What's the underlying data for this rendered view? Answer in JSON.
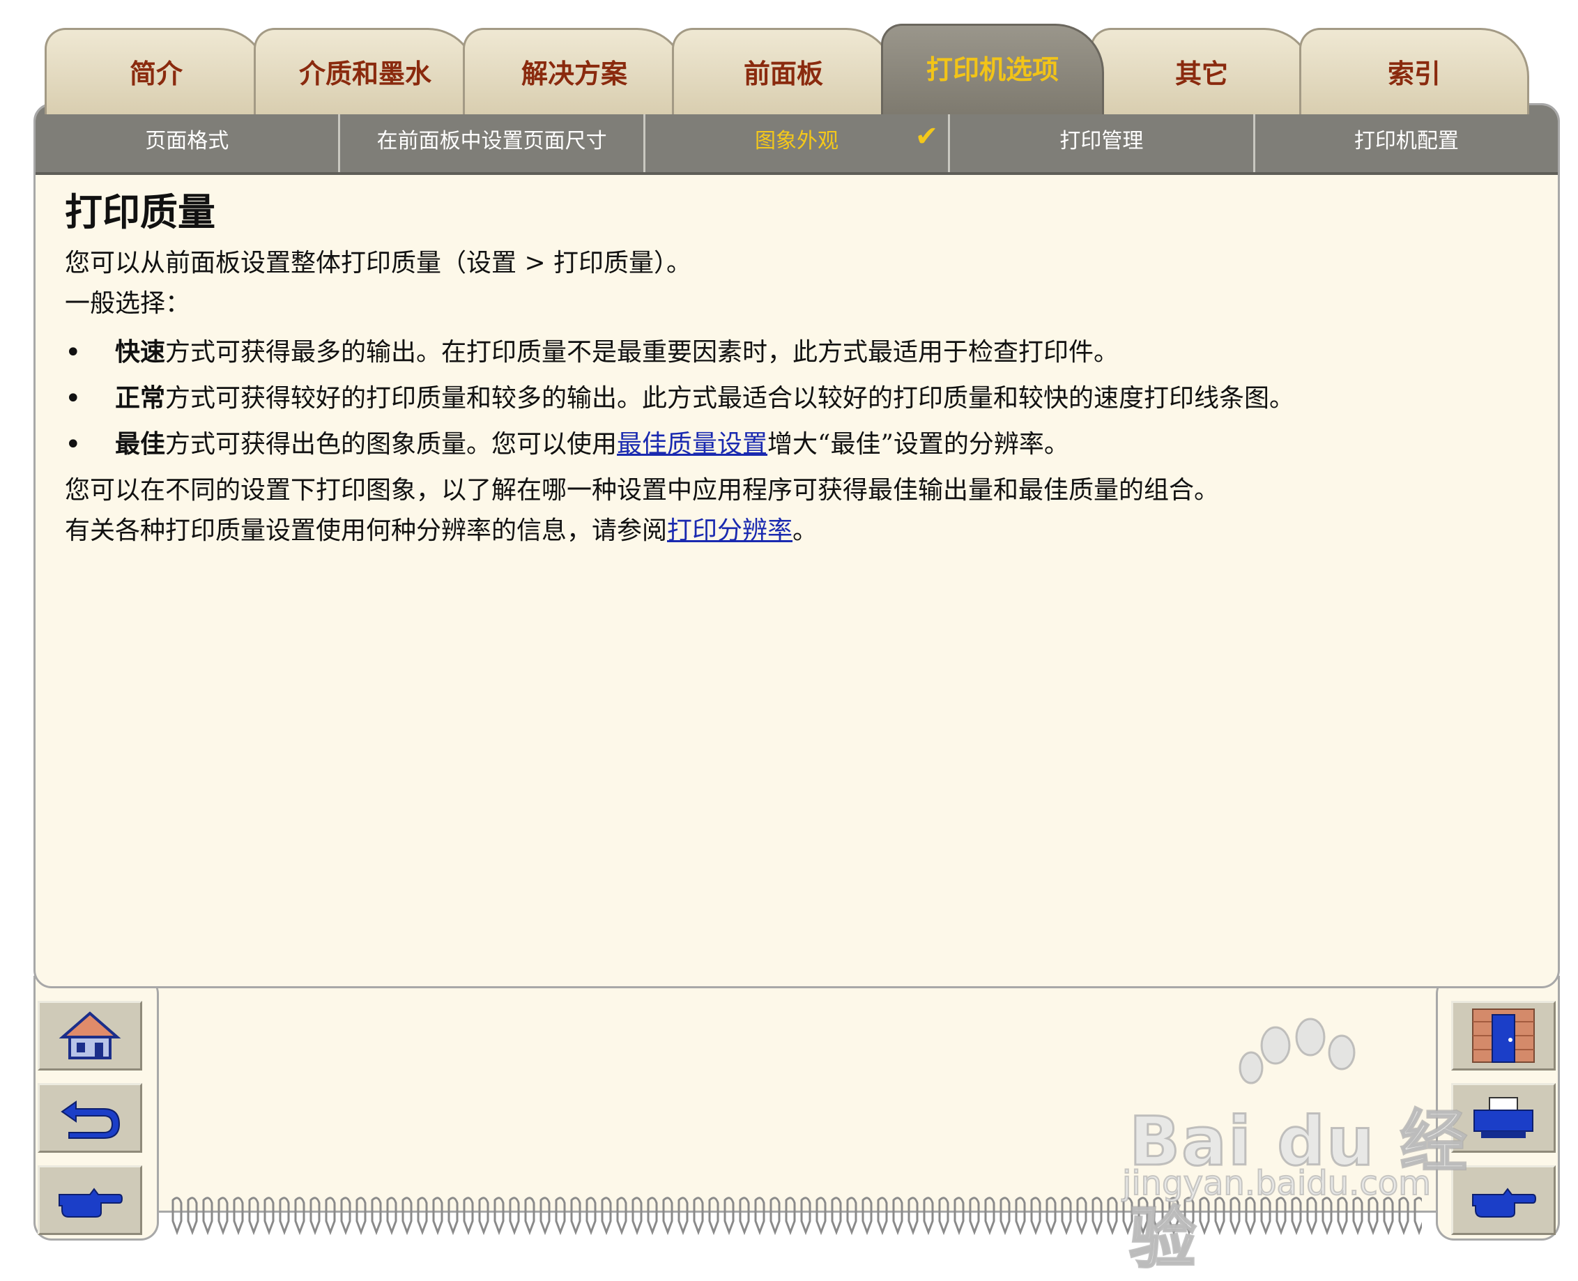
{
  "tabs": [
    {
      "label": "简介"
    },
    {
      "label": "介质和墨水"
    },
    {
      "label": "解决方案"
    },
    {
      "label": "前面板"
    },
    {
      "label": "打印机选项",
      "active": true
    },
    {
      "label": "其它"
    },
    {
      "label": "索引"
    }
  ],
  "subtabs": [
    {
      "label": "页面格式"
    },
    {
      "label": "在前面板中设置页面尺寸"
    },
    {
      "label": "图象外观",
      "active": true,
      "checked": true
    },
    {
      "label": "打印管理"
    },
    {
      "label": "打印机配置"
    }
  ],
  "checkmark": "✔",
  "content": {
    "title": "打印质量",
    "intro": "您可以从前面板设置整体打印质量（设置 > 打印质量）。",
    "general_label": "一般选择：",
    "bullet_char": "•",
    "bullets": [
      {
        "keyword": "快速",
        "text": "方式可获得最多的输出。在打印质量不是最重要因素时，此方式最适用于检查打印件。"
      },
      {
        "keyword": "正常",
        "text": "方式可获得较好的打印质量和较多的输出。此方式最适合以较好的打印质量和较快的速度打印线条图。"
      },
      {
        "keyword": "最佳",
        "text_before": "方式可获得出色的图象质量。您可以使用",
        "link": "最佳质量设置",
        "text_after": "增大“最佳”设置的分辨率。"
      }
    ],
    "para2": "您可以在不同的设置下打印图象，以了解在哪一种设置中应用程序可获得最佳输出量和最佳质量的组合。",
    "para3_before": "有关各种打印质量设置使用何种分辨率的信息，请参阅",
    "para3_link": "打印分辨率",
    "para3_after": "。"
  },
  "nav": {
    "left": [
      "home-icon",
      "back-icon",
      "forward-icon"
    ],
    "right": [
      "door-icon",
      "printer-icon",
      "forward-icon"
    ]
  },
  "watermark": {
    "brand": "Bai du 经验",
    "url": "jingyan.baidu.com"
  },
  "colors": {
    "tab_text": "#8a2a0e",
    "active_text": "#f2c418",
    "link": "#1a2ab0",
    "panel_bg": "#fdf8e9",
    "subbar_bg": "#7f7e78"
  }
}
